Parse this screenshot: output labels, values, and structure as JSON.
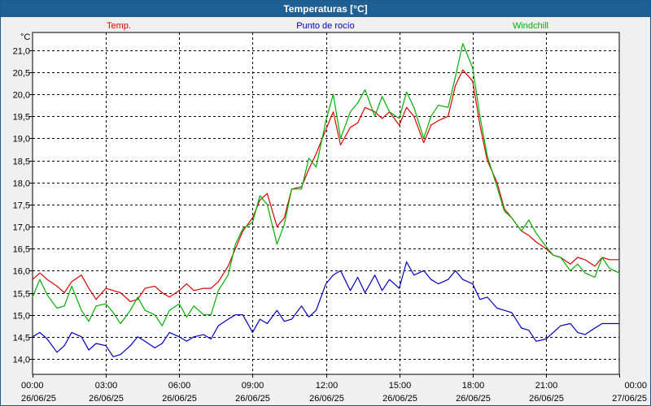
{
  "window": {
    "title": "Temperaturas [°C]"
  },
  "chart_data": {
    "type": "line",
    "ylabel": "°C",
    "ylim": [
      13.65,
      21.4
    ],
    "yticks": [
      "14,0",
      "14,5",
      "15,0",
      "15,5",
      "16,0",
      "16,5",
      "17,0",
      "17,5",
      "18,0",
      "18,5",
      "19,0",
      "19,5",
      "20,0",
      "20,5",
      "21,0"
    ],
    "ytick_values": [
      14.0,
      14.5,
      15.0,
      15.5,
      16.0,
      16.5,
      17.0,
      17.5,
      18.0,
      18.5,
      19.0,
      19.5,
      20.0,
      20.5,
      21.0
    ],
    "xlim": [
      0,
      24
    ],
    "xticks": [
      {
        "time": "00:00",
        "date": "26/06/25",
        "hour": 0
      },
      {
        "time": "03:00",
        "date": "26/06/25",
        "hour": 3
      },
      {
        "time": "06:00",
        "date": "26/06/25",
        "hour": 6
      },
      {
        "time": "09:00",
        "date": "26/06/25",
        "hour": 9
      },
      {
        "time": "12:00",
        "date": "26/06/25",
        "hour": 12
      },
      {
        "time": "15:00",
        "date": "26/06/25",
        "hour": 15
      },
      {
        "time": "18:00",
        "date": "26/06/25",
        "hour": 18
      },
      {
        "time": "21:00",
        "date": "26/06/25",
        "hour": 21
      },
      {
        "time": "00:00",
        "date": "27/06/25",
        "hour": 24
      }
    ],
    "grid": true,
    "legend_position": "top",
    "series": [
      {
        "name": "Temp.",
        "color": "#e00000",
        "x": [
          0,
          0.3,
          0.6,
          1,
          1.3,
          1.6,
          2,
          2.3,
          2.6,
          3,
          3.3,
          3.6,
          4,
          4.3,
          4.6,
          5,
          5.3,
          5.6,
          6,
          6.3,
          6.6,
          7,
          7.3,
          7.6,
          8,
          8.3,
          8.6,
          9,
          9.3,
          9.6,
          10,
          10.3,
          10.6,
          11,
          11.3,
          11.6,
          12,
          12.3,
          12.6,
          13,
          13.3,
          13.6,
          14,
          14.3,
          14.6,
          15,
          15.3,
          15.6,
          16,
          16.3,
          16.6,
          17,
          17.3,
          17.6,
          18,
          18.3,
          18.6,
          19,
          19.3,
          19.6,
          20,
          20.3,
          20.6,
          21,
          21.3,
          21.6,
          22,
          22.3,
          22.6,
          23,
          23.3,
          23.6,
          24
        ],
        "values": [
          15.8,
          15.95,
          15.8,
          15.65,
          15.5,
          15.75,
          15.9,
          15.6,
          15.35,
          15.6,
          15.55,
          15.5,
          15.3,
          15.35,
          15.6,
          15.65,
          15.5,
          15.4,
          15.55,
          15.7,
          15.55,
          15.6,
          15.6,
          15.75,
          16.1,
          16.5,
          16.9,
          17.2,
          17.6,
          17.75,
          17.0,
          17.2,
          17.85,
          17.9,
          18.3,
          18.65,
          19.2,
          19.6,
          18.85,
          19.25,
          19.35,
          19.7,
          19.6,
          19.45,
          19.6,
          19.3,
          19.7,
          19.5,
          18.9,
          19.3,
          19.4,
          19.5,
          20.2,
          20.55,
          20.3,
          19.3,
          18.5,
          18.0,
          17.4,
          17.2,
          16.9,
          16.8,
          16.65,
          16.5,
          16.35,
          16.3,
          16.15,
          16.3,
          16.25,
          16.1,
          16.3,
          16.25,
          16.25
        ]
      },
      {
        "name": "Punto de rocío",
        "color": "#0000c0",
        "x": [
          0,
          0.3,
          0.6,
          1,
          1.3,
          1.6,
          2,
          2.3,
          2.6,
          3,
          3.3,
          3.6,
          4,
          4.3,
          4.6,
          5,
          5.3,
          5.6,
          6,
          6.3,
          6.6,
          7,
          7.3,
          7.6,
          8,
          8.3,
          8.6,
          9,
          9.3,
          9.6,
          10,
          10.3,
          10.6,
          11,
          11.3,
          11.6,
          12,
          12.3,
          12.6,
          13,
          13.3,
          13.6,
          14,
          14.3,
          14.6,
          15,
          15.3,
          15.6,
          16,
          16.3,
          16.6,
          17,
          17.3,
          17.6,
          18,
          18.3,
          18.6,
          19,
          19.3,
          19.6,
          20,
          20.3,
          20.6,
          21,
          21.3,
          21.6,
          22,
          22.3,
          22.6,
          23,
          23.3,
          23.6,
          24
        ],
        "values": [
          14.5,
          14.6,
          14.45,
          14.15,
          14.3,
          14.6,
          14.5,
          14.2,
          14.35,
          14.3,
          14.05,
          14.1,
          14.3,
          14.5,
          14.4,
          14.25,
          14.35,
          14.6,
          14.5,
          14.4,
          14.5,
          14.55,
          14.45,
          14.75,
          14.9,
          15.0,
          15.0,
          14.6,
          14.9,
          14.8,
          15.1,
          14.85,
          14.9,
          15.2,
          14.95,
          15.1,
          15.7,
          15.9,
          16.0,
          15.55,
          15.85,
          15.5,
          15.9,
          15.55,
          15.8,
          15.6,
          16.2,
          15.9,
          16.0,
          15.8,
          15.7,
          15.8,
          16.0,
          15.8,
          15.7,
          15.35,
          15.4,
          15.15,
          15.1,
          15.05,
          14.7,
          14.65,
          14.4,
          14.45,
          14.6,
          14.75,
          14.8,
          14.6,
          14.55,
          14.7,
          14.8,
          14.8,
          14.8
        ]
      },
      {
        "name": "Windchill",
        "color": "#00b000",
        "x": [
          0,
          0.3,
          0.6,
          1,
          1.3,
          1.6,
          2,
          2.3,
          2.6,
          3,
          3.3,
          3.6,
          4,
          4.3,
          4.6,
          5,
          5.3,
          5.6,
          6,
          6.3,
          6.6,
          7,
          7.3,
          7.6,
          8,
          8.3,
          8.6,
          9,
          9.3,
          9.6,
          10,
          10.3,
          10.6,
          11,
          11.3,
          11.6,
          12,
          12.3,
          12.6,
          13,
          13.3,
          13.6,
          14,
          14.3,
          14.6,
          15,
          15.3,
          15.6,
          16,
          16.3,
          16.6,
          17,
          17.3,
          17.6,
          18,
          18.3,
          18.6,
          19,
          19.3,
          19.6,
          20,
          20.3,
          20.6,
          21,
          21.3,
          21.6,
          22,
          22.3,
          22.6,
          23,
          23.3,
          23.6,
          24
        ],
        "values": [
          15.4,
          15.8,
          15.45,
          15.15,
          15.2,
          15.65,
          15.1,
          14.85,
          15.2,
          15.25,
          15.05,
          14.8,
          15.1,
          15.4,
          15.1,
          15.0,
          14.75,
          15.1,
          15.25,
          14.95,
          15.2,
          15.0,
          15.0,
          15.55,
          15.9,
          16.6,
          16.95,
          17.1,
          17.7,
          17.5,
          16.6,
          17.05,
          17.85,
          17.85,
          18.55,
          18.35,
          19.4,
          20.0,
          19.0,
          19.6,
          19.8,
          20.1,
          19.5,
          19.95,
          19.6,
          19.45,
          20.05,
          19.7,
          19.0,
          19.5,
          19.75,
          19.7,
          20.4,
          21.15,
          20.6,
          19.5,
          18.6,
          17.9,
          17.35,
          17.2,
          16.9,
          17.15,
          16.85,
          16.55,
          16.35,
          16.3,
          16.0,
          16.15,
          15.95,
          15.85,
          16.3,
          16.05,
          15.95
        ]
      }
    ]
  }
}
